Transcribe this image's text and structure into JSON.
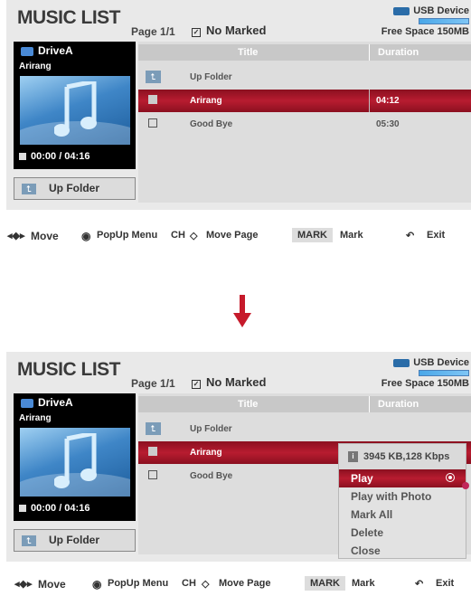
{
  "screen": {
    "title": "MUSIC LIST",
    "page": "Page 1/1",
    "marked": "No Marked",
    "usb_label": "USB Device",
    "free_space": "Free Space 150MB",
    "drive": "DriveA",
    "now_playing": "Arirang",
    "time": "00:00 / 04:16",
    "up_folder_button": "Up Folder",
    "columns": {
      "title": "Title",
      "duration": "Duration"
    },
    "rows": [
      {
        "name": "Up Folder",
        "duration": ""
      },
      {
        "name": "Arirang",
        "duration": "04:12"
      },
      {
        "name": "Good Bye",
        "duration": "05:30"
      }
    ]
  },
  "bottom": {
    "move": "Move",
    "popup_menu": "PopUp Menu",
    "ch": "CH",
    "move_page": "Move Page",
    "mark_key": "MARK",
    "mark": "Mark",
    "exit": "Exit"
  },
  "popup": {
    "info": "3945 KB,128 Kbps",
    "items": [
      "Play",
      "Play with Photo",
      "Mark All",
      "Delete",
      "Close"
    ]
  },
  "colors": {
    "selected_row": "#a5182a",
    "panel_bg": "#e9e9e9",
    "pin": "#c1275a"
  }
}
